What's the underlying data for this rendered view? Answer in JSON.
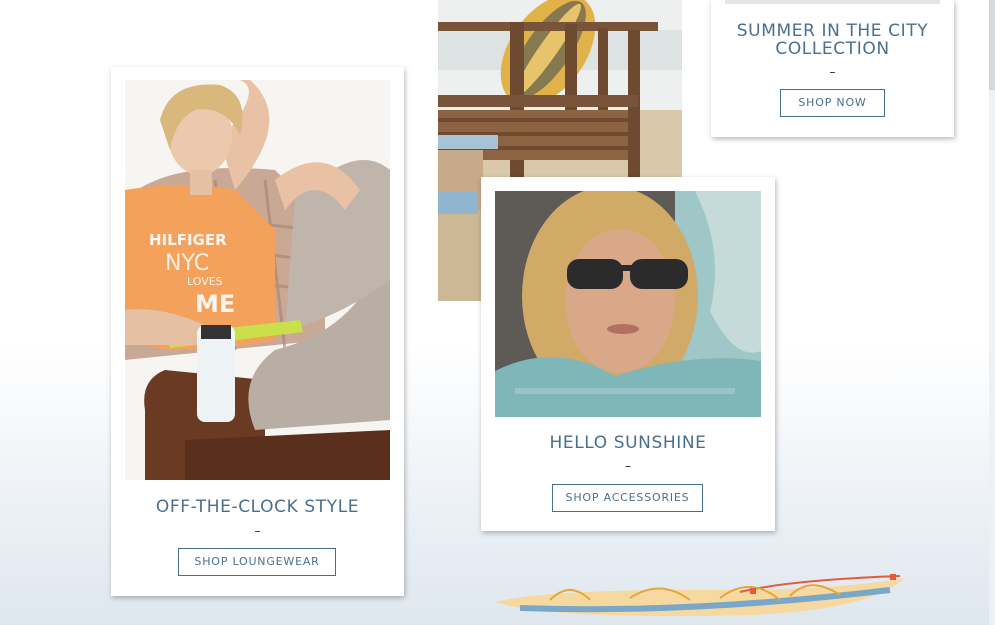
{
  "cards": [
    {
      "title": "OFF-THE-CLOCK STYLE",
      "separator": "–",
      "button": "SHOP LOUNGEWEAR"
    },
    {
      "title": "HELLO SUNSHINE",
      "separator": "–",
      "button": "SHOP ACCESSORIES"
    },
    {
      "title_line1": "SUMMER IN THE CITY",
      "title_line2": "COLLECTION",
      "separator": "–",
      "button": "SHOP NOW"
    }
  ],
  "photos": {
    "tshirt_print_line1": "HILFIGER",
    "tshirt_print_line2": "NYC",
    "tshirt_print_line3": "LOVES",
    "tshirt_print_line4": "ME"
  },
  "colors": {
    "accent": "#4a6f8d",
    "background": "#ffffff"
  }
}
